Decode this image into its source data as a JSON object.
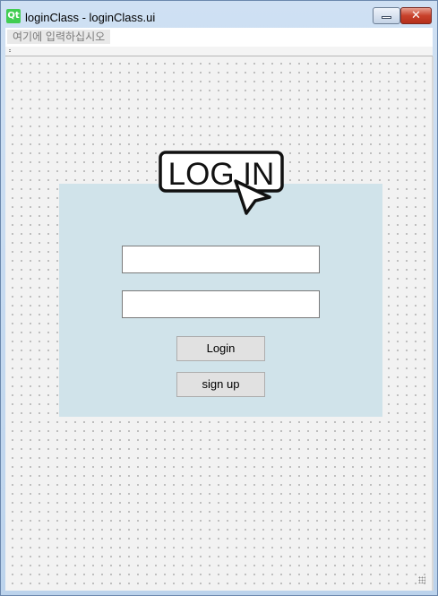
{
  "window": {
    "title": "loginClass - loginClass.ui",
    "qt_logo": "Qt",
    "close_glyph": "✕"
  },
  "menubar": {
    "hint": "여기에 입력하십시오"
  },
  "login_panel": {
    "logo_text": "LOG IN",
    "username_value": "",
    "password_value": "",
    "login_label": "Login",
    "signup_label": "sign up"
  },
  "colors": {
    "panel_bg": "#d0e3ea",
    "canvas_bg": "#f2f2f2",
    "close_red": "#c8412b"
  },
  "icons": [
    "qt-logo-icon",
    "minimize-icon",
    "close-icon",
    "cursor-arrow-icon",
    "size-grip-icon"
  ]
}
